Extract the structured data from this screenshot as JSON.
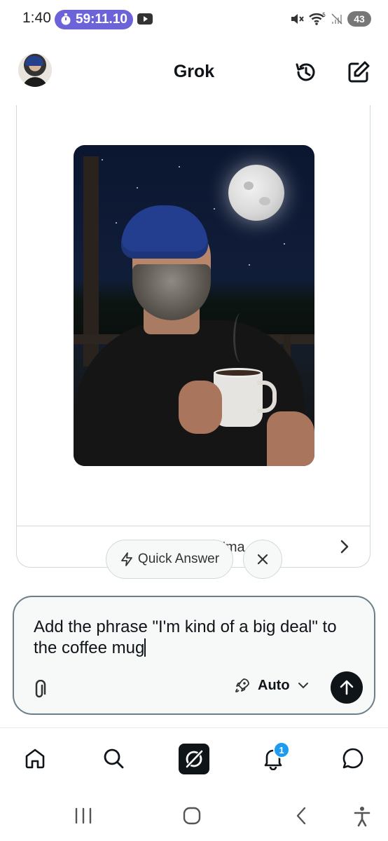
{
  "status_bar": {
    "time": "1:40",
    "timer": "59:11.10",
    "battery": "43"
  },
  "header": {
    "title": "Grok"
  },
  "card": {
    "footer_text": "'ma",
    "image_icon": "generated-image"
  },
  "quick_chip": {
    "label": "Quick Answer"
  },
  "input": {
    "value": "Add the phrase \"I'm kind of a big deal\" to the coffee mug",
    "mode_label": "Auto"
  },
  "bottom_nav": {
    "items": [
      "home-icon",
      "search-icon",
      "grok-icon",
      "notifications-icon",
      "messages-icon"
    ],
    "notification_count": "1"
  },
  "colors": {
    "timer_pill": "#6c63d9",
    "accent_blue": "#1d9bf0",
    "dark": "#0f1419"
  }
}
